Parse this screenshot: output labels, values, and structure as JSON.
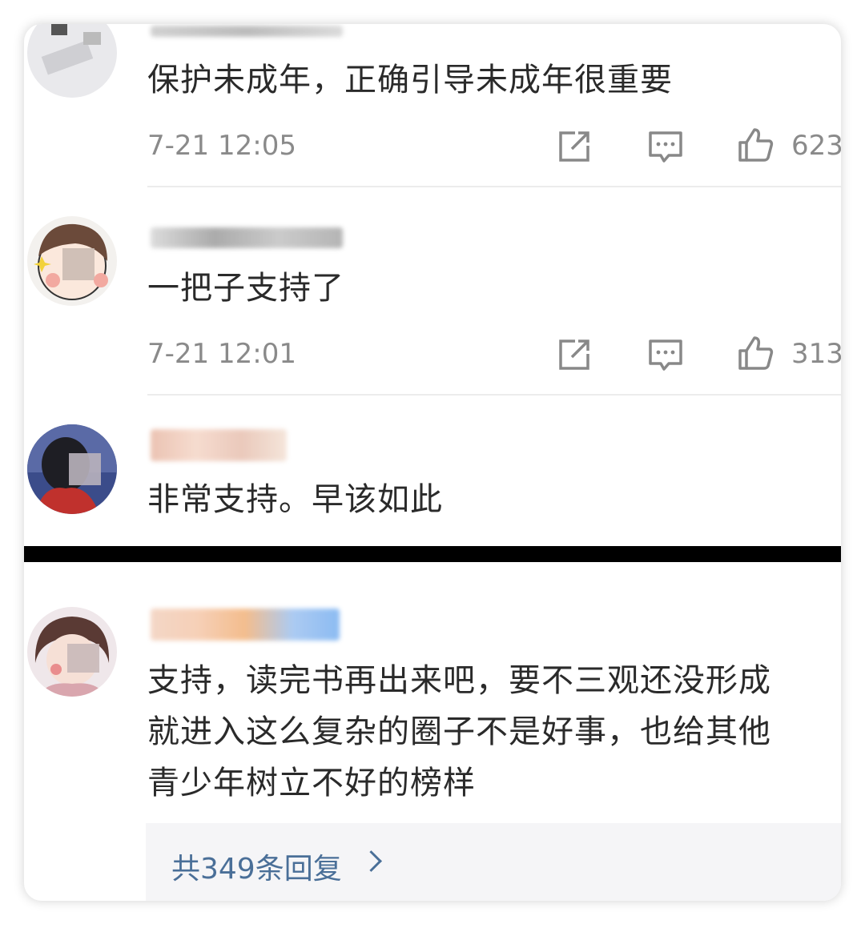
{
  "comments": [
    {
      "text": "保护未成年，正确引导未成年很重要",
      "time": "7-21 12:05",
      "likes": "623"
    },
    {
      "text": "一把子支持了",
      "time": "7-21 12:01",
      "likes": "313"
    },
    {
      "text": "非常支持。早该如此"
    },
    {
      "text_lines": [
        "支持，读完书再出来吧，要不三观还没形成",
        "就进入这么复杂的圈子不是好事，也给其他",
        "青少年树立不好的榜样"
      ],
      "replies_label": "共349条回复"
    }
  ],
  "icons": {
    "share": "share-icon",
    "comment": "comment-icon",
    "like": "thumbs-up-icon",
    "chevron": "chevron-right-icon"
  },
  "colors": {
    "link": "#4a6f98",
    "meta": "#8a8a8a",
    "text": "#2a2a2a"
  }
}
